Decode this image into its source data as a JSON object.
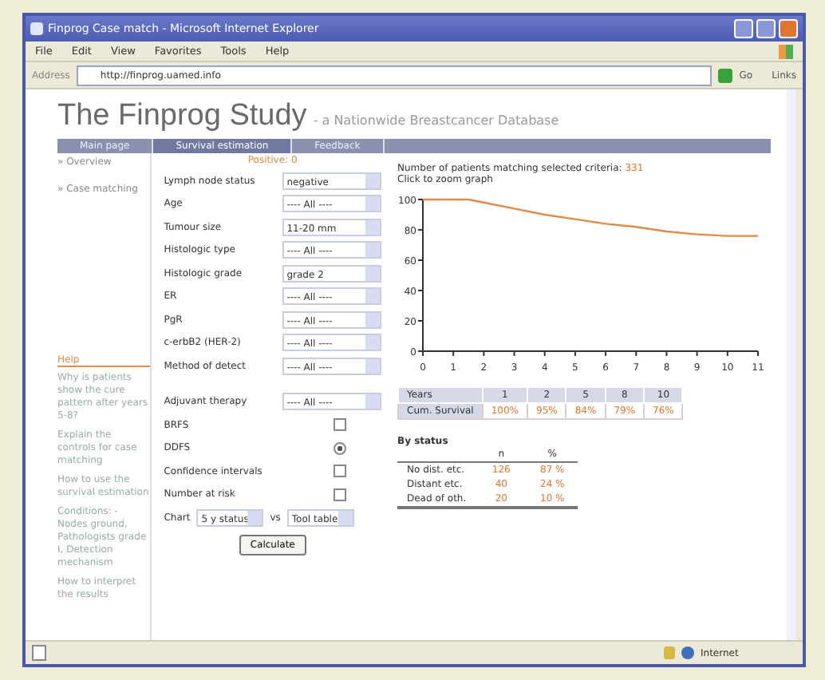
{
  "window": {
    "title": "Finprog Case match - Microsoft Internet Explorer"
  },
  "menu": [
    "File",
    "Edit",
    "View",
    "Favorites",
    "Tools",
    "Help"
  ],
  "address": {
    "label": "Address",
    "value": "http://finprog.uamed.info",
    "go": "Go",
    "links": "Links"
  },
  "page": {
    "title": "The Finprog Study",
    "subtitle": "- a Nationwide Breastcancer Database",
    "nav": [
      {
        "label": "Main page",
        "selected": false
      },
      {
        "label": "Survival estimation",
        "selected": true
      },
      {
        "label": "Feedback",
        "selected": false
      }
    ],
    "sidebar": {
      "items": [
        "» Overview",
        "» Case matching"
      ],
      "help_title": "Help",
      "help_links": [
        "Why is patients show the cure pattern after years 5-8?",
        "Explain the controls for case matching",
        "How to use the survival estimation",
        "Conditions: - Nodes ground, Pathologists grade I, Detection mechanism",
        "How to interpret the results"
      ]
    },
    "form": {
      "note": "Positive: 0",
      "selects": [
        {
          "label": "Lymph node status",
          "value": "negative"
        },
        {
          "label": "Age",
          "value": "---- All ----"
        },
        {
          "label": "Tumour size",
          "value": "11-20 mm"
        },
        {
          "label": "Histologic type",
          "value": "---- All ----"
        },
        {
          "label": "Histologic grade",
          "value": "grade 2"
        },
        {
          "label": "ER",
          "value": "---- All ----"
        },
        {
          "label": "PgR",
          "value": "---- All ----"
        },
        {
          "label": "c-erbB2 (HER-2)",
          "value": "---- All ----"
        },
        {
          "label": "Method of detect",
          "value": "---- All ----"
        }
      ],
      "adjuvant": {
        "label": "Adjuvant therapy",
        "value": "---- All ----"
      },
      "options": [
        {
          "label": "BRFS",
          "kind": "checkbox",
          "checked": false
        },
        {
          "label": "DDFS",
          "kind": "radio",
          "checked": true
        },
        {
          "label": "Confidence intervals",
          "kind": "checkbox",
          "checked": false
        },
        {
          "label": "Number at risk",
          "kind": "checkbox",
          "checked": false
        }
      ],
      "chart_label": "Chart",
      "chart_x": "5 y status",
      "vs": "vs",
      "chart_y": "Tool table",
      "calculate": "Calculate"
    },
    "results": {
      "count_label": "Number of patients matching selected criteria:",
      "count": "331",
      "zoom_hint": "Click to zoom graph",
      "chart_data": {
        "type": "line",
        "x": [
          0,
          1,
          1.5,
          2,
          3,
          4,
          5,
          6,
          7,
          8,
          9,
          10,
          11
        ],
        "series": [
          {
            "color": "#e08a4a",
            "values": [
              100,
              100,
              100,
              98,
              94,
              90,
              87,
              84,
              82,
              79,
              77,
              76,
              76
            ]
          }
        ],
        "xlim": [
          0,
          11
        ],
        "ylim": [
          0,
          100
        ],
        "xticks": [
          0,
          1,
          2,
          3,
          4,
          5,
          6,
          7,
          8,
          9,
          10,
          11
        ],
        "yticks": [
          0,
          20,
          40,
          60,
          80,
          100
        ]
      },
      "survival_table": {
        "header": [
          "Years",
          "1",
          "2",
          "5",
          "8",
          "10"
        ],
        "row": [
          "Cum. Survival",
          "100%",
          "95%",
          "84%",
          "79%",
          "76%"
        ]
      },
      "status": {
        "title": "By status",
        "columns": [
          "",
          "n",
          "%"
        ],
        "rows": [
          [
            "No dist. etc.",
            "126",
            "87 %"
          ],
          [
            "Distant etc.",
            "40",
            "24 %"
          ],
          [
            "Dead of oth.",
            "20",
            "10 %"
          ]
        ]
      }
    }
  },
  "status_bar": {
    "zone": "Internet"
  }
}
